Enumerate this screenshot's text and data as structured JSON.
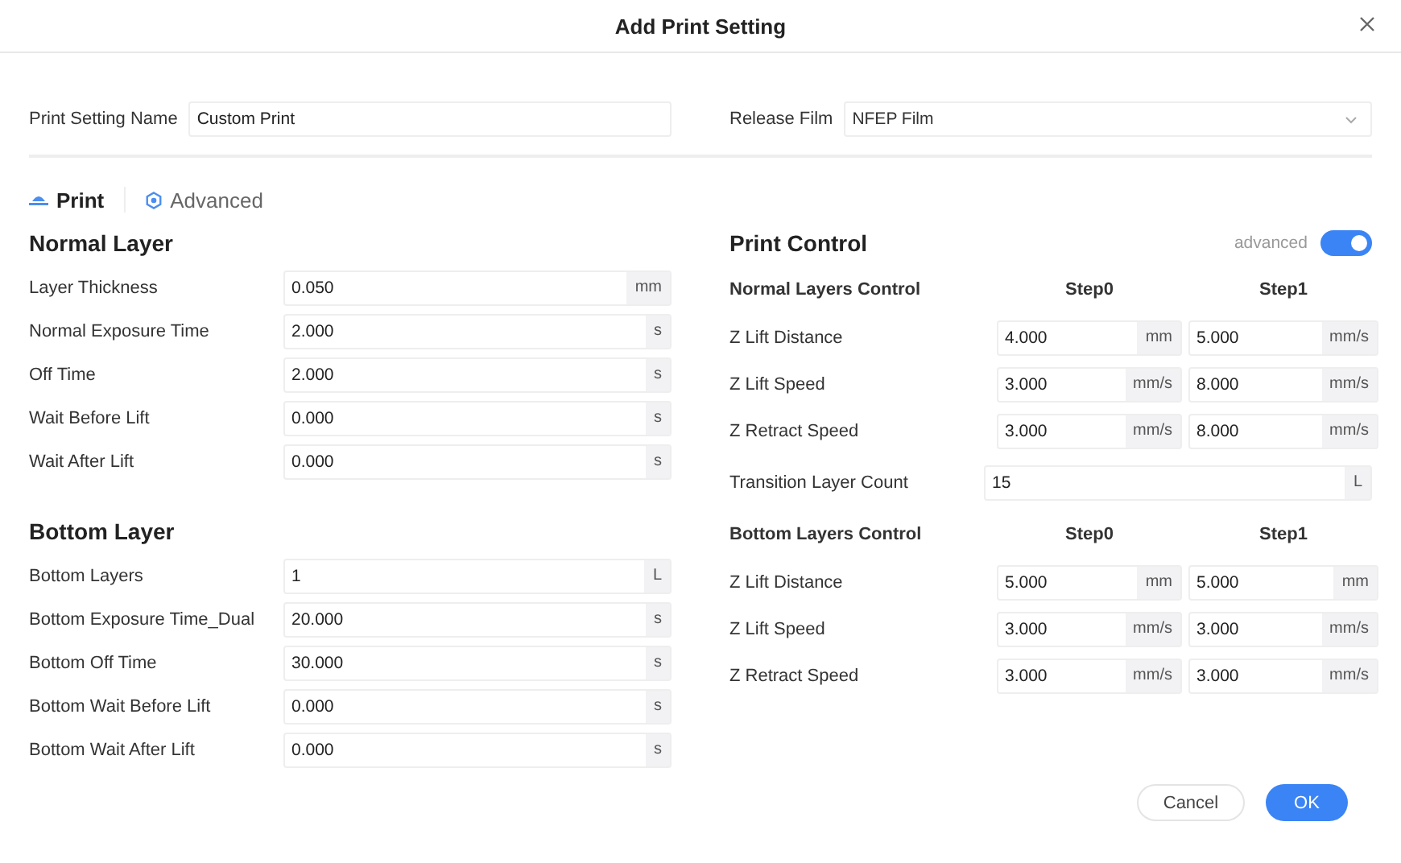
{
  "window": {
    "title": "Add Print Setting"
  },
  "header_fields": [
    {
      "kind": "text",
      "label": "Print Setting Name",
      "value": "Custom Print"
    },
    {
      "kind": "select",
      "label": "Release Film",
      "value": "NFEP Film"
    }
  ],
  "tabs": [
    {
      "kind": "print",
      "label": "Print",
      "selected": true
    },
    {
      "kind": "advanced",
      "label": "Advanced",
      "selected": false
    }
  ],
  "normal_layer": {
    "title": "Normal Layer",
    "rows": [
      {
        "label": "Layer Thickness",
        "value": "0.050",
        "unit": "mm"
      },
      {
        "label": "Normal Exposure Time",
        "value": "2.000",
        "unit": "s"
      },
      {
        "label": "Off Time",
        "value": "2.000",
        "unit": "s"
      },
      {
        "label": "Wait Before Lift",
        "value": "0.000",
        "unit": "s"
      },
      {
        "label": "Wait After Lift",
        "value": "0.000",
        "unit": "s"
      }
    ]
  },
  "bottom_layer": {
    "title": "Bottom Layer",
    "rows": [
      {
        "label": "Bottom Layers",
        "value": "1",
        "unit": "L"
      },
      {
        "label": "Bottom Exposure Time_Dual",
        "value": "20.000",
        "unit": "s"
      },
      {
        "label": "Bottom Off Time",
        "value": "30.000",
        "unit": "s"
      },
      {
        "label": "Bottom Wait Before Lift",
        "value": "0.000",
        "unit": "s"
      },
      {
        "label": "Bottom Wait After Lift",
        "value": "0.000",
        "unit": "s"
      }
    ]
  },
  "print_control": {
    "title": "Print Control",
    "toggle": {
      "label": "advanced",
      "on": true
    },
    "normal_layers": {
      "title": "Normal Layers Control",
      "columns": [
        "Step0",
        "Step1"
      ],
      "rows": [
        {
          "label": "Z Lift Distance",
          "cells": [
            {
              "value": "4.000",
              "unit": "mm"
            },
            {
              "value": "5.000",
              "unit": "mm/s"
            }
          ]
        },
        {
          "label": "Z Lift Speed",
          "cells": [
            {
              "value": "3.000",
              "unit": "mm/s"
            },
            {
              "value": "8.000",
              "unit": "mm/s"
            }
          ]
        },
        {
          "label": "Z Retract Speed",
          "cells": [
            {
              "value": "3.000",
              "unit": "mm/s"
            },
            {
              "value": "8.000",
              "unit": "mm/s"
            }
          ]
        }
      ]
    },
    "transition": {
      "label": "Transition Layer Count",
      "value": "15",
      "unit": "L"
    },
    "bottom_layers": {
      "title": "Bottom Layers Control",
      "columns": [
        "Step0",
        "Step1"
      ],
      "rows": [
        {
          "label": "Z Lift Distance",
          "cells": [
            {
              "value": "5.000",
              "unit": "mm"
            },
            {
              "value": "5.000",
              "unit": "mm"
            }
          ]
        },
        {
          "label": "Z Lift Speed",
          "cells": [
            {
              "value": "3.000",
              "unit": "mm/s"
            },
            {
              "value": "3.000",
              "unit": "mm/s"
            }
          ]
        },
        {
          "label": "Z Retract Speed",
          "cells": [
            {
              "value": "3.000",
              "unit": "mm/s"
            },
            {
              "value": "3.000",
              "unit": "mm/s"
            }
          ]
        }
      ]
    }
  },
  "buttons": [
    {
      "kind": "secondary",
      "label": "Cancel"
    },
    {
      "kind": "primary",
      "label": "OK"
    }
  ]
}
